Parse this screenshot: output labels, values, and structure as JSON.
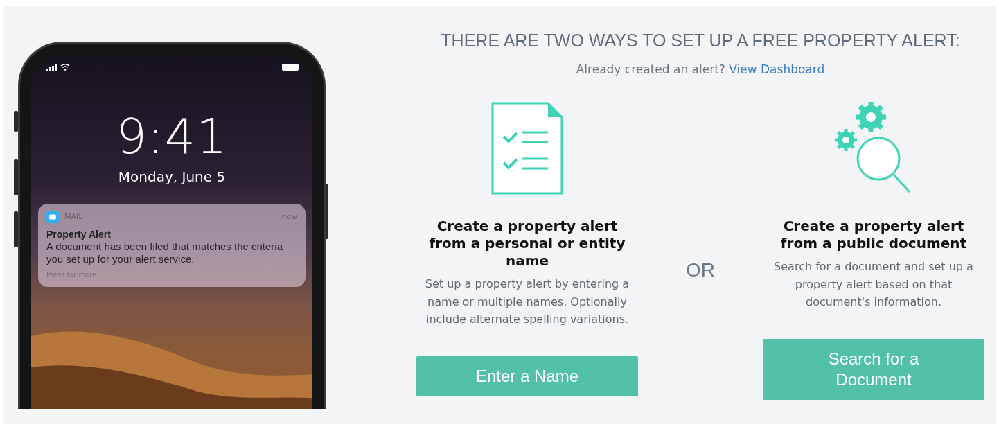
{
  "phone": {
    "time": "9:41",
    "date": "Monday, June 5",
    "notification": {
      "app": "MAIL",
      "time": "now",
      "title": "Property Alert",
      "body": "A document has been filed that matches the criteria you set up for your alert service.",
      "hint": "Press for more"
    }
  },
  "heading": "THERE ARE TWO WAYS TO SET UP A FREE PROPERTY ALERT:",
  "subline": {
    "text": "Already created an alert?",
    "link": "View Dashboard"
  },
  "options": [
    {
      "kind": "name",
      "title": "Create a property alert from a personal or entity name",
      "description": "Set up a property alert by entering a name or multiple names. Optionally include alternate spelling variations.",
      "button": "Enter a Name"
    },
    {
      "kind": "document",
      "title": "Create a property alert from a public document",
      "description": "Search for a document and set up a property alert based on that document's information.",
      "button": "Search for a Document"
    }
  ],
  "separator": "OR"
}
